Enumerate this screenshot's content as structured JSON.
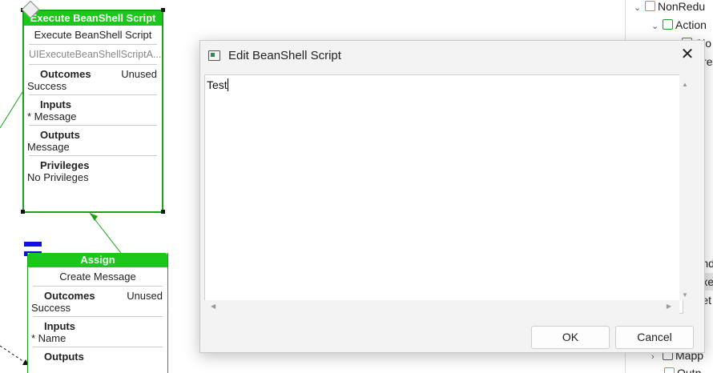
{
  "node1": {
    "header": "Execute BeanShell Script",
    "name": "Execute BeanShell Script",
    "ui_id": "UIExecuteBeanShellScriptA...",
    "outcomes_title": "Outcomes",
    "outcomes_status": "Unused",
    "outcomes_value": "Success",
    "inputs_title": "Inputs",
    "inputs_value": "* Message",
    "outputs_title": "Outputs",
    "outputs_value": "Message",
    "privileges_title": "Privileges",
    "privileges_value": "No Privileges"
  },
  "node2": {
    "header": "Assign",
    "name": "Create Message",
    "outcomes_title": "Outcomes",
    "outcomes_status": "Unused",
    "outcomes_value": "Success",
    "inputs_title": "Inputs",
    "inputs_value": "* Name",
    "outputs_title": "Outputs"
  },
  "tree": {
    "items": [
      "NonRedu",
      "Action",
      "Clo",
      "Cre",
      "End",
      "Exe",
      "Set",
      "uts",
      "ks",
      "Mapp",
      "Outp"
    ]
  },
  "dialog": {
    "title": "Edit BeanShell Script",
    "script_text": "Test",
    "ok_label": "OK",
    "cancel_label": "Cancel"
  },
  "colors": {
    "node_green": "#19c819",
    "selection": "#e6e6e6"
  }
}
